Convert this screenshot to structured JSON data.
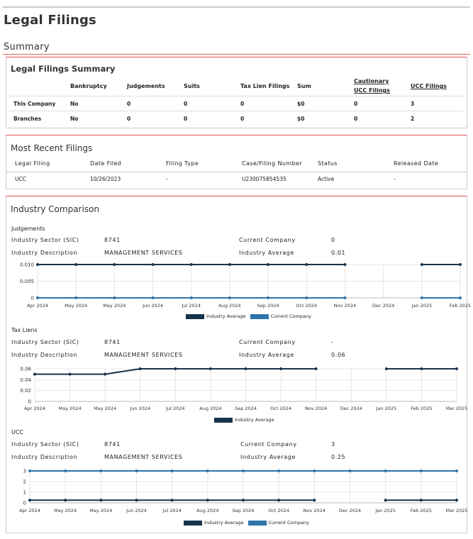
{
  "page_title": "Legal Filings",
  "section_title": "Summary",
  "colors": {
    "accent_red": "#d9534f",
    "industry_average": "#17344d",
    "current_company": "#2e75aa"
  },
  "summary": {
    "title": "Legal Filings Summary",
    "headers": [
      "Bankruptcy",
      "Judgements",
      "Suits",
      "Tax Lien Filings",
      "Sum",
      "Cautionary UCC Filings",
      "UCC Filings"
    ],
    "header_cautionary_line1": "Cautionary",
    "header_cautionary_line2": "UCC Filings",
    "rows": [
      {
        "label": "This Company",
        "bankruptcy": "No",
        "judgements": "0",
        "suits": "0",
        "tax_lien": "0",
        "sum": "$0",
        "cautionary": "0",
        "ucc": "3"
      },
      {
        "label": "Branches",
        "bankruptcy": "No",
        "judgements": "0",
        "suits": "0",
        "tax_lien": "0",
        "sum": "$0",
        "cautionary": "0",
        "ucc": "2"
      }
    ]
  },
  "recent": {
    "title": "Most Recent Filings",
    "headers": [
      "Legal Filing",
      "Date Filed",
      "Filing Type",
      "Case/Filing Number",
      "Status",
      "Released Date"
    ],
    "rows": [
      {
        "legal_filing": "UCC",
        "date_filed": "10/26/2023",
        "filing_type": "-",
        "case_number": "U230075854535",
        "status": "Active",
        "released": "-"
      }
    ]
  },
  "industry": {
    "title": "Industry Comparison",
    "labels": {
      "sector": "Industry Sector (SIC)",
      "description": "Industry Description",
      "current": "Current Company",
      "average": "Industry Average"
    },
    "legend": {
      "average": "Industry Average",
      "current": "Current Company"
    },
    "blocks": [
      {
        "name": "Judgements",
        "sector": "8741",
        "description": "MANAGEMENT SERVICES",
        "current": "0",
        "average": "0.01"
      },
      {
        "name": "Tax Liens",
        "sector": "8741",
        "description": "MANAGEMENT SERVICES",
        "current": "-",
        "average": "0.06"
      },
      {
        "name": "UCC",
        "sector": "8741",
        "description": "MANAGEMENT SERVICES",
        "current": "3",
        "average": "0.25"
      }
    ]
  },
  "chart_data": [
    {
      "type": "line",
      "title": "Judgements",
      "x": [
        "Apr 2024",
        "May 2024",
        "May 2024",
        "Jun 2024",
        "Jul 2024",
        "Aug 2024",
        "Sep 2024",
        "Oct 2024",
        "Nov 2024",
        "Dec 2024",
        "Jan 2025",
        "Feb 2025"
      ],
      "yticks": [
        "0.010",
        "0.005",
        "0"
      ],
      "ylim": [
        0,
        0.01
      ],
      "series": [
        {
          "name": "Industry Average",
          "color": "#17344d",
          "values": [
            0.01,
            0.01,
            0.01,
            0.01,
            0.01,
            0.01,
            0.01,
            0.01,
            0.01,
            null,
            0.01,
            0.01
          ]
        },
        {
          "name": "Current Company",
          "color": "#2e75aa",
          "values": [
            0,
            0,
            0,
            0,
            0,
            0,
            0,
            0,
            0,
            null,
            0,
            0
          ]
        }
      ],
      "legend": "bottom"
    },
    {
      "type": "line",
      "title": "Tax Liens",
      "x": [
        "Apr 2024",
        "May 2024",
        "May 2024",
        "Jun 2024",
        "Jul 2024",
        "Aug 2024",
        "Sep 2024",
        "Oct 2024",
        "Nov 2024",
        "Dec 2024",
        "Jan 2025",
        "Feb 2025",
        "Mar 2025"
      ],
      "yticks": [
        "0.06",
        "0.04",
        "0.02",
        "0"
      ],
      "ylim": [
        0,
        0.06
      ],
      "series": [
        {
          "name": "Industry Average",
          "color": "#17344d",
          "values": [
            0.05,
            0.05,
            0.05,
            0.06,
            0.06,
            0.06,
            0.06,
            0.06,
            0.06,
            null,
            0.06,
            0.06,
            0.06
          ]
        }
      ],
      "legend": "bottom"
    },
    {
      "type": "line",
      "title": "UCC",
      "x": [
        "Apr 2024",
        "May 2024",
        "May 2024",
        "Jun 2024",
        "Jul 2024",
        "Aug 2024",
        "Sep 2024",
        "Oct 2024",
        "Nov 2024",
        "Dec 2024",
        "Jan 2025",
        "Feb 2025",
        "Mar 2025"
      ],
      "yticks": [
        "3",
        "2",
        "1",
        "0"
      ],
      "ylim": [
        0,
        3
      ],
      "series": [
        {
          "name": "Industry Average",
          "color": "#17344d",
          "values": [
            0.25,
            0.25,
            0.25,
            0.25,
            0.25,
            0.25,
            0.25,
            0.25,
            0.25,
            null,
            0.25,
            0.25,
            0.25
          ]
        },
        {
          "name": "Current Company",
          "color": "#2e75aa",
          "values": [
            3,
            3,
            3,
            3,
            3,
            3,
            3,
            3,
            3,
            3,
            3,
            3,
            3
          ]
        }
      ],
      "legend": "bottom"
    }
  ]
}
